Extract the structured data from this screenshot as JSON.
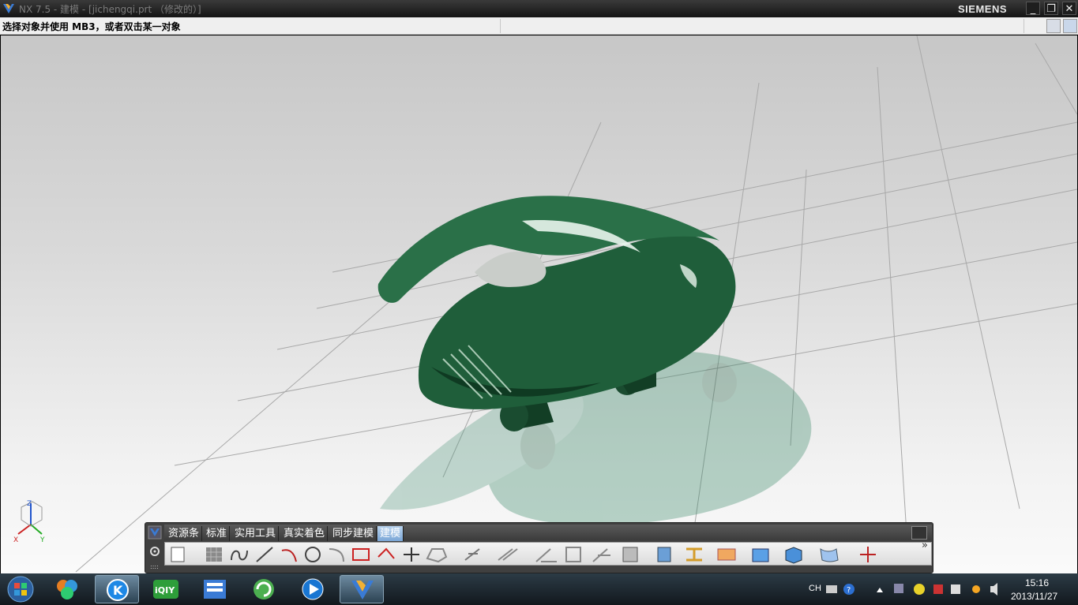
{
  "window": {
    "title": "NX 7.5 - 建模 - [jichengqi.prt （修改的）]",
    "brand": "SIEMENS",
    "minimize_label": "_",
    "restore_label": "❐",
    "close_label": "✕"
  },
  "prompt": {
    "text": "选择对象并使用 MB3，或者双击某一对象"
  },
  "toolbar": {
    "tabs": [
      {
        "label": "资源条"
      },
      {
        "label": "标准"
      },
      {
        "label": "实用工具"
      },
      {
        "label": "真实着色"
      },
      {
        "label": "同步建模"
      },
      {
        "label": "建模"
      }
    ],
    "active_tab": "建模",
    "more_label": "»",
    "icons": [
      "view-rectangle-icon",
      "shaded-grid-icon",
      "spline-icon",
      "line-icon",
      "arc-icon",
      "circle-icon",
      "fillet-icon",
      "rectangle-icon",
      "point-icon",
      "datum-plus-icon",
      "polygon-icon",
      "trim-icon",
      "offset-icon",
      "mirror-icon",
      "pattern-icon",
      "derived-icon",
      "block-icon",
      "extrude-icon",
      "revolve-icon",
      "cylinder-icon",
      "sweep-icon",
      "cube-icon",
      "surface-icon",
      "csys-icon"
    ]
  },
  "viewport": {
    "model_color": "#1f5e3a",
    "triad_labels": {
      "z": "Z",
      "x": "X",
      "y": "Y"
    }
  },
  "taskbar": {
    "apps": [
      {
        "name": "start-orb"
      },
      {
        "name": "media-center"
      },
      {
        "name": "kugou"
      },
      {
        "name": "iqiyi"
      },
      {
        "name": "file-manager"
      },
      {
        "name": "refresh-app"
      },
      {
        "name": "media-player"
      },
      {
        "name": "nx-app"
      }
    ],
    "lang": "CH",
    "time": "15:16",
    "date": "2013/11/27"
  }
}
